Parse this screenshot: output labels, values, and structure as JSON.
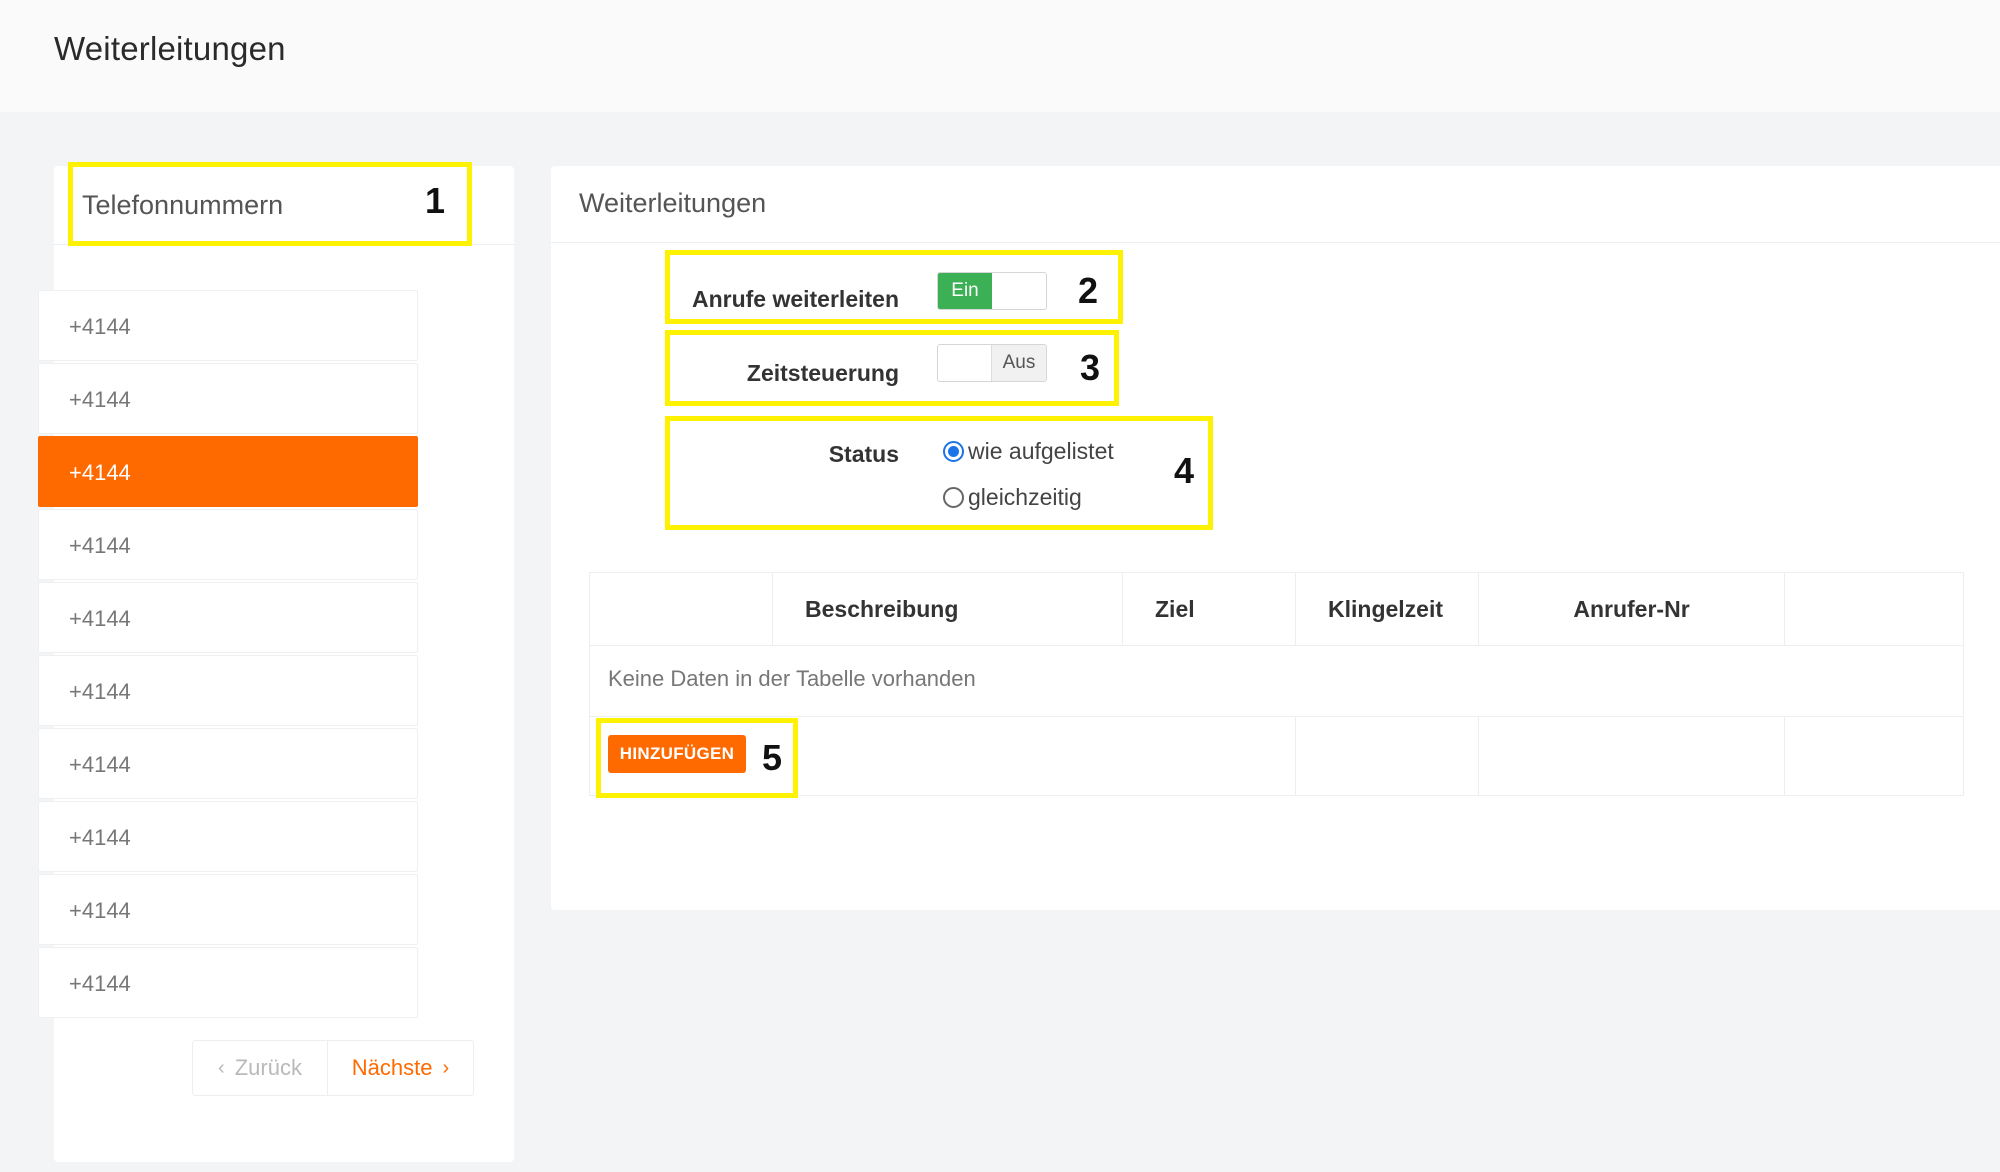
{
  "header": {
    "title": "Weiterleitungen"
  },
  "left_panel": {
    "title": "Telefonnummern",
    "phone_numbers": [
      "+4144",
      "+4144",
      "+4144",
      "+4144",
      "+4144",
      "+4144",
      "+4144",
      "+4144",
      "+4144",
      "+4144"
    ],
    "active_index": 2,
    "pager": {
      "prev_label": "Zurück",
      "next_label": "Nächste"
    }
  },
  "right_panel": {
    "title": "Weiterleitungen",
    "forward_calls": {
      "label": "Anrufe weiterleiten",
      "state": "Ein"
    },
    "time_control": {
      "label": "Zeitsteuerung",
      "state": "Aus"
    },
    "status": {
      "label": "Status",
      "options": [
        "wie aufgelistet",
        "gleichzeitig"
      ],
      "selected": "wie aufgelistet"
    },
    "table": {
      "columns": [
        "",
        "Beschreibung",
        "Ziel",
        "Klingelzeit",
        "Anrufer-Nr",
        ""
      ],
      "empty_message": "Keine Daten in der Tabelle vorhanden",
      "add_label": "HINZUFÜGEN"
    }
  },
  "annotations": [
    "1",
    "2",
    "3",
    "4",
    "5"
  ],
  "colors": {
    "accent": "#ff6a00",
    "toggle_on": "#3cb054",
    "highlight": "#fff200"
  }
}
